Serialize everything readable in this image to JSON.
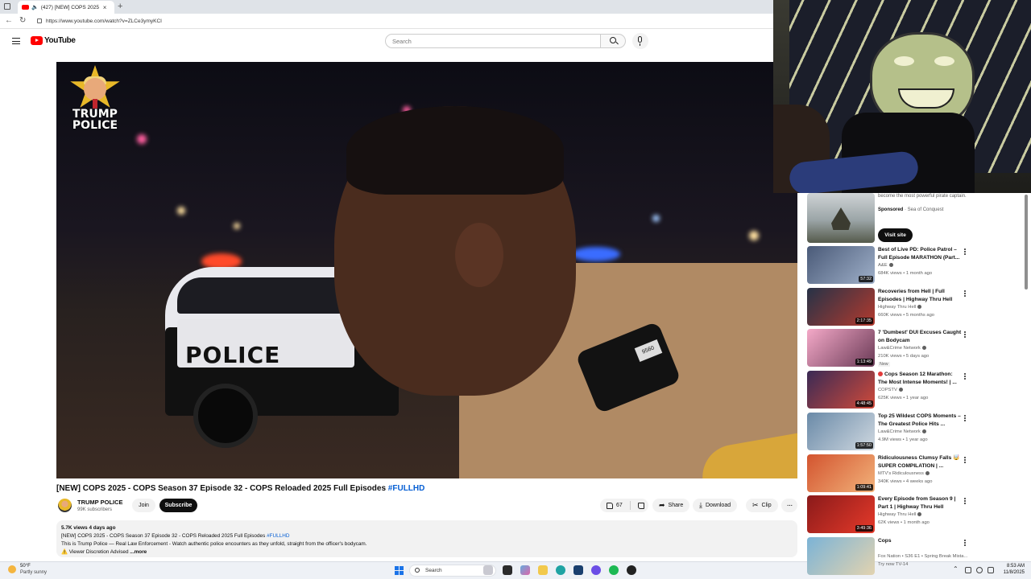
{
  "browser": {
    "tab_title": "(427) [NEW] COPS 2025 - CO",
    "tab_close": "×",
    "new_tab": "+",
    "back": "←",
    "reload": "↻",
    "url": "https://www.youtube.com/watch?v=ZLCe3ymyKCI"
  },
  "header": {
    "logo_text": "YouTube",
    "search_placeholder": "Search"
  },
  "video": {
    "overlay_logo_line1": "TRUMP",
    "overlay_logo_line2": "POLICE",
    "car_text": "POLICE",
    "camera_text": "9560",
    "title_main": "[NEW] COPS 2025 - COPS Season 37 Episode 32 - COPS Reloaded 2025 Full Episodes ",
    "title_hashtag": "#FULLHD"
  },
  "channel": {
    "name": "TRUMP POLICE",
    "subscribers": "99K subscribers",
    "join_label": "Join",
    "subscribe_label": "Subscribe"
  },
  "actions": {
    "like_count": "67",
    "share_label": "Share",
    "download_label": "Download",
    "clip_label": "Clip",
    "more_label": "···"
  },
  "description": {
    "meta": "5.7K views  4 days ago",
    "line1_main": "[NEW] COPS 2025 - COPS Season 37 Episode 32 - COPS Reloaded 2025 Full Episodes ",
    "line1_hashtag": "#FULLHD",
    "line2": "This is Trump Police — Real Law Enforcement - Watch authentic police encounters as they unfold, straight from the officer's bodycam.",
    "line3": "⚠️ Viewer Discretion Advised",
    "more_label": "...more"
  },
  "sidebar": {
    "ad": {
      "text": "become the most powerful pirate captain.",
      "sponsored": "Sponsored",
      "advertiser": " · Sea of Conquest",
      "button": "Visit site"
    },
    "recommendations": [
      {
        "title": "Best of Live PD: Police Patrol – Full Episode MARATHON (Part...",
        "channel": "A&E",
        "verified": true,
        "meta": "684K views • 1 month ago",
        "duration": "57:32",
        "badge": ""
      },
      {
        "title": "Recoveries from Hell | Full Episodes | Highway Thru Hell",
        "channel": "Highway Thru Hell",
        "verified": true,
        "meta": "660K views • 5 months ago",
        "duration": "2:17:35",
        "badge": ""
      },
      {
        "title": "7 'Dumbest' DUI Excuses Caught on Bodycam",
        "channel": "Law&Crime Network",
        "verified": true,
        "meta": "210K views • 5 days ago",
        "duration": "1:13:49",
        "badge": "New"
      },
      {
        "title": "Cops Season 12 Marathon: The Most Intense Moments! | ...",
        "channel": "COPSTV",
        "verified": true,
        "meta": "625K views • 1 year ago",
        "duration": "4:48:45",
        "badge": "",
        "red_dot": true
      },
      {
        "title": "Top 25 Wildest COPS Moments – The Greatest Police Hits ...",
        "channel": "Law&Crime Network",
        "verified": true,
        "meta": "4.9M views • 1 year ago",
        "duration": "1:57:50",
        "badge": ""
      },
      {
        "title": "Ridiculousness Clumsy Falls 🤯 SUPER COMPILATION | ...",
        "channel": "MTV's Ridiculousness",
        "verified": true,
        "meta": "340K views • 4 weeks ago",
        "duration": "1:09:41",
        "badge": ""
      },
      {
        "title": "Every Episode from Season 9 | Part 1 | Highway Thru Hell",
        "channel": "Highway Thru Hell",
        "verified": true,
        "meta": "62K views • 1 month ago",
        "duration": "3:49:36",
        "badge": ""
      },
      {
        "title": "Cops",
        "channel": "Fox Nation • S36 E1 • Spring Break Mista...",
        "verified": false,
        "meta": "Try now   TV-14",
        "duration": "",
        "badge": ""
      }
    ]
  },
  "taskbar": {
    "weather_temp": "50°F",
    "weather_desc": "Partly sunny",
    "search_label": "Search",
    "time": "8:53 AM",
    "date": "11/8/2025",
    "tray_up": "⌃"
  },
  "colors": {
    "youtube_red": "#ff0000",
    "link_blue": "#065fd4",
    "subscribe_bg": "#0f0f0f"
  }
}
